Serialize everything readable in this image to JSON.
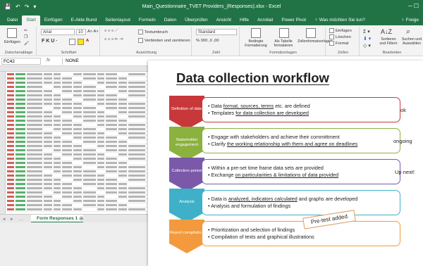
{
  "window": {
    "title": "Main_Questionnaire_TVET Providers_(Responses).xlsx  -  Excel",
    "qat": [
      "💾",
      "↶",
      "↷",
      "▾"
    ],
    "buttons": "─   ☐"
  },
  "ribbon_tabs": [
    "Datei",
    "Start",
    "Einfügen",
    "E-Akte Bund",
    "Seitenlayout",
    "Formeln",
    "Daten",
    "Überprüfen",
    "Ansicht",
    "Hilfe",
    "Acrobat",
    "Power Pivot",
    "♀ Was möchten Sie tun?"
  ],
  "active_tab": "Start",
  "share_label": "♀ Freige",
  "ribbon": {
    "clipboard": {
      "paste": "Einfügen",
      "label": "Zwischenablage"
    },
    "font": {
      "name": "Arial",
      "size": "10",
      "grow": "A˄ A˅",
      "styles": "F  K  U  ·",
      "label": "Schriftart"
    },
    "alignment": {
      "wrap": "Textumbruch",
      "merge": "Verbinden und zentrieren",
      "label": "Ausrichtung"
    },
    "number": {
      "format": "Standard",
      "symbols": "% 000 ,0 ,00",
      "label": "Zahl"
    },
    "styles": {
      "conditional": "Bedingte Formatierung",
      "table": "Als Tabelle formatieren",
      "cell": "Zellenformatvorlagen",
      "label": "Formatvorlagen"
    },
    "cells": {
      "insert": "Einfügen",
      "delete": "Löschen",
      "format": "Format",
      "label": "Zellen"
    },
    "editing": {
      "sort": "Sortieren und Filtern",
      "find": "Suchen und Auswählen",
      "label": "Bearbeiten"
    }
  },
  "formula_bar": {
    "cell": "FC42",
    "fx": "fx",
    "value": "NONE"
  },
  "sheet_tab": "Form Responses 1",
  "slide": {
    "title": "Data collection workflow",
    "steps": [
      {
        "label": "Definition of data",
        "color": "#c8383b",
        "bullets": [
          [
            "Data ",
            "format, sources, terms",
            " etc. are defined"
          ],
          [
            "Templates ",
            "for data collection are developed",
            ""
          ]
        ],
        "status": "ok"
      },
      {
        "label": "Stakeholder engagement",
        "color": "#8bb13f",
        "bullets": [
          [
            "Engage with stakeholders and achieve their committment",
            "",
            ""
          ],
          [
            "Clarify ",
            "the working relationship with them and agree on deadlines",
            ""
          ]
        ],
        "status": "ongoing"
      },
      {
        "label": "Collection period",
        "color": "#7b59a8",
        "bullets": [
          [
            "Within a pre-set time frame data sets are provided",
            "",
            ""
          ],
          [
            "Exchange ",
            "on particularities & limitations of data provided",
            ""
          ]
        ],
        "status": "Up next!"
      },
      {
        "label": "Analysis",
        "color": "#3eb1c8",
        "bullets": [
          [
            "Data is ",
            "analyzed, indicators calculated",
            " and graphs are developed"
          ],
          [
            "Analysis and formulation of findings",
            "",
            ""
          ]
        ],
        "status": ""
      },
      {
        "label": "Report compilation",
        "color": "#f29a3d",
        "bullets": [
          [
            "Prioritization and selection of findings",
            "",
            ""
          ],
          [
            "Compilation of texts and graphical illustrations",
            "",
            ""
          ]
        ],
        "status": ""
      }
    ],
    "callout": "Pre-test added"
  }
}
